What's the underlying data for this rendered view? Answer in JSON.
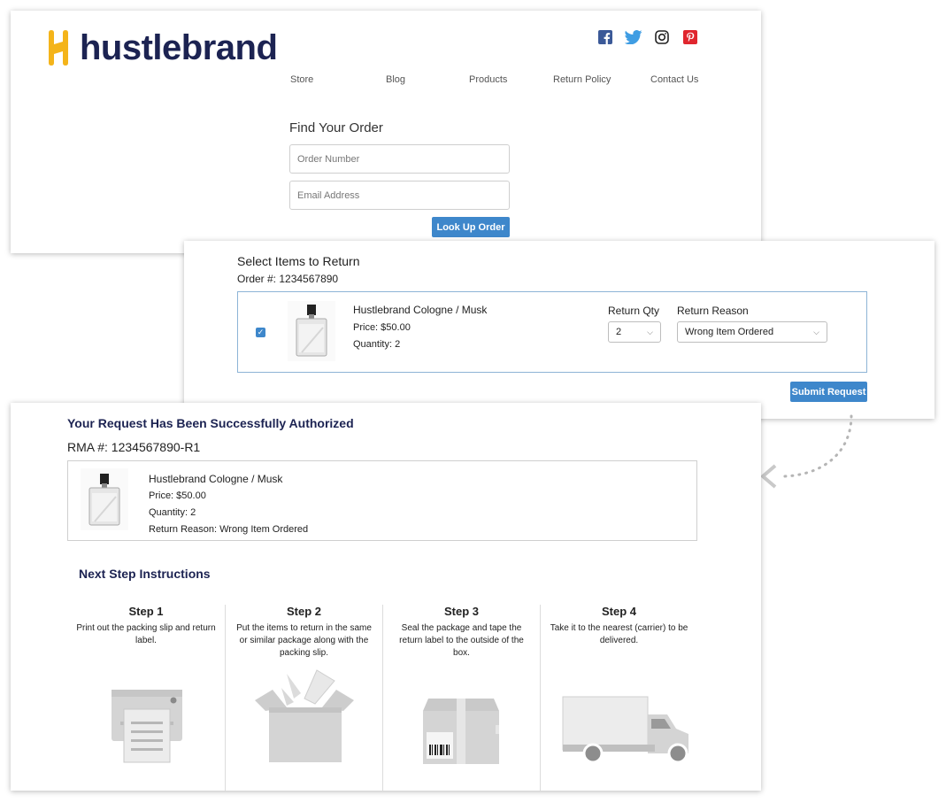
{
  "brand": {
    "name": "hustlebrand",
    "mark": "H",
    "mark_color": "#f4b41a",
    "text_color": "#1c2352"
  },
  "social": [
    {
      "name": "facebook-icon",
      "glyph": "f",
      "color": "#3b5998"
    },
    {
      "name": "twitter-icon",
      "glyph": "t",
      "color": "#3f9de3"
    },
    {
      "name": "instagram-icon",
      "glyph": "◎",
      "color": "#222222"
    },
    {
      "name": "pinterest-icon",
      "glyph": "p",
      "color": "#e0262e"
    }
  ],
  "nav": [
    "Store",
    "Blog",
    "Products",
    "Return Policy",
    "Contact Us"
  ],
  "lookup": {
    "title": "Find Your Order",
    "order_placeholder": "Order Number",
    "email_placeholder": "Email Address",
    "button": "Look Up Order"
  },
  "select_items": {
    "title": "Select Items to Return",
    "order_label": "Order #: 1234567890",
    "item": {
      "name": "Hustlebrand Cologne / Musk",
      "price": "Price: $50.00",
      "quantity": "Quantity: 2",
      "checked": true
    },
    "qty_label": "Return Qty",
    "qty_value": "2",
    "reason_label": "Return Reason",
    "reason_value": "Wrong Item Ordered",
    "submit": "Submit Request"
  },
  "authorized": {
    "title": "Your Request Has Been Successfully Authorized",
    "rma": "RMA #: 1234567890-R1",
    "item": {
      "name": "Hustlebrand Cologne / Musk",
      "price": "Price: $50.00",
      "quantity": "Quantity: 2",
      "reason": "Return Reason: Wrong Item Ordered"
    },
    "next_title": "Next Step Instructions",
    "steps": [
      {
        "title": "Step 1",
        "desc": "Print out the packing slip and return label.",
        "icon": "printer-icon"
      },
      {
        "title": "Step 2",
        "desc": "Put the items to return in the same or similar package along with the packing slip.",
        "icon": "open-box-icon"
      },
      {
        "title": "Step 3",
        "desc": "Seal the package and tape the return label to the outside of the box.",
        "icon": "sealed-box-icon"
      },
      {
        "title": "Step 4",
        "desc": "Take it to the nearest (carrier) to be delivered.",
        "icon": "delivery-truck-icon"
      }
    ]
  },
  "colors": {
    "accent": "#3e87cb",
    "navy": "#1c2352",
    "illustration_gray": "#d4d4d4"
  }
}
